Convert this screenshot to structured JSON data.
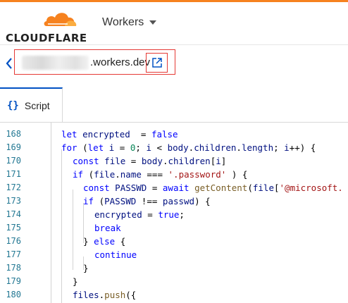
{
  "brand": {
    "logo_text": "CLOUDFLARE",
    "accent": "#f6821f"
  },
  "header": {
    "product_label": "Workers",
    "caret_icon": "chevron-down-icon"
  },
  "url_bar": {
    "domain_suffix": ".workers.dev",
    "back_icon": "chevron-left-icon",
    "open_icon": "external-link-icon",
    "highlight_color": "#e53935"
  },
  "tabs": [
    {
      "icon": "{}",
      "label": "Script"
    }
  ],
  "editor": {
    "lines": [
      {
        "num": "168",
        "segments": [
          [
            "kw",
            "let"
          ],
          [
            "id",
            " encrypted"
          ],
          [
            "",
            "  = "
          ],
          [
            "kw",
            "false"
          ]
        ]
      },
      {
        "num": "169",
        "segments": [
          [
            "kw",
            "for"
          ],
          [
            "",
            " ("
          ],
          [
            "kw",
            "let"
          ],
          [
            "id",
            " i"
          ],
          [
            "",
            " = "
          ],
          [
            "num",
            "0"
          ],
          [
            "",
            "; "
          ],
          [
            "id",
            "i"
          ],
          [
            "",
            " < "
          ],
          [
            "id",
            "body"
          ],
          [
            "",
            "."
          ],
          [
            "id",
            "children"
          ],
          [
            "",
            "."
          ],
          [
            "id",
            "length"
          ],
          [
            "",
            "; "
          ],
          [
            "id",
            "i"
          ],
          [
            "",
            "++) {"
          ]
        ]
      },
      {
        "num": "170",
        "segments": [
          [
            "kw",
            "const"
          ],
          [
            "id",
            " file"
          ],
          [
            "",
            " = "
          ],
          [
            "id",
            "body"
          ],
          [
            "",
            "."
          ],
          [
            "id",
            "children"
          ],
          [
            "",
            "["
          ],
          [
            "id",
            "i"
          ],
          [
            "",
            "]"
          ]
        ]
      },
      {
        "num": "171",
        "segments": [
          [
            "kw",
            "if"
          ],
          [
            "",
            " ("
          ],
          [
            "id",
            "file"
          ],
          [
            "",
            "."
          ],
          [
            "id",
            "name"
          ],
          [
            "",
            " === "
          ],
          [
            "str",
            "'.password'"
          ],
          [
            "",
            " ) {"
          ]
        ]
      },
      {
        "num": "172",
        "segments": [
          [
            "kw",
            "const"
          ],
          [
            "id",
            " PASSWD"
          ],
          [
            "",
            " = "
          ],
          [
            "kw",
            "await"
          ],
          [
            "",
            " "
          ],
          [
            "fn",
            "getContent"
          ],
          [
            "",
            "("
          ],
          [
            "id",
            "file"
          ],
          [
            "",
            "["
          ],
          [
            "str",
            "'@microsoft."
          ]
        ]
      },
      {
        "num": "173",
        "segments": [
          [
            "kw",
            "if"
          ],
          [
            "",
            " ("
          ],
          [
            "id",
            "PASSWD"
          ],
          [
            "",
            " !== "
          ],
          [
            "id",
            "passwd"
          ],
          [
            "",
            ") {"
          ]
        ]
      },
      {
        "num": "174",
        "segments": [
          [
            "id",
            "encrypted"
          ],
          [
            "",
            " = "
          ],
          [
            "kw",
            "true"
          ],
          [
            "",
            ";"
          ]
        ]
      },
      {
        "num": "175",
        "segments": [
          [
            "kw",
            "break"
          ]
        ]
      },
      {
        "num": "176",
        "segments": [
          [
            "",
            "} "
          ],
          [
            "kw",
            "else"
          ],
          [
            "",
            " {"
          ]
        ]
      },
      {
        "num": "177",
        "segments": [
          [
            "kw",
            "continue"
          ]
        ]
      },
      {
        "num": "178",
        "segments": [
          [
            "",
            "}"
          ]
        ]
      },
      {
        "num": "179",
        "segments": [
          [
            "",
            "}"
          ]
        ]
      },
      {
        "num": "180",
        "segments": [
          [
            "id",
            "files"
          ],
          [
            "",
            "."
          ],
          [
            "fn",
            "push"
          ],
          [
            "",
            "({"
          ]
        ]
      }
    ]
  }
}
